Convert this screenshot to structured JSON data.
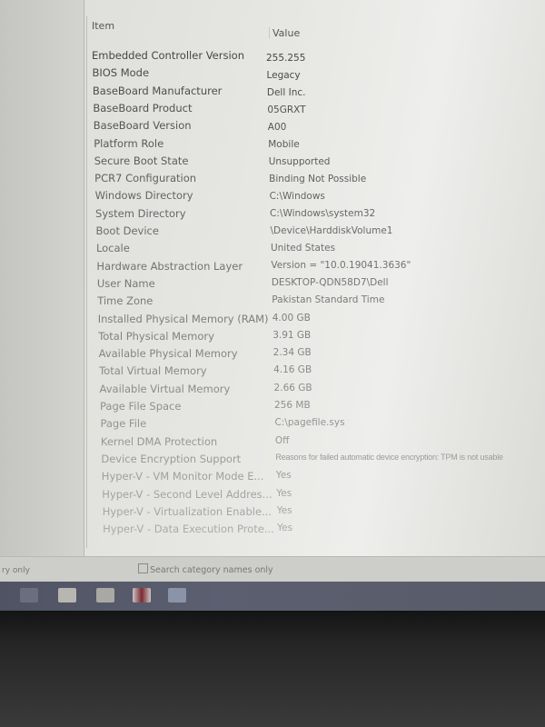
{
  "header": {
    "item": "Item",
    "value": "Value"
  },
  "rows": [
    {
      "item": "Embedded Controller Version",
      "value": "255.255"
    },
    {
      "item": "BIOS Mode",
      "value": "Legacy"
    },
    {
      "item": "BaseBoard Manufacturer",
      "value": "Dell Inc."
    },
    {
      "item": "BaseBoard Product",
      "value": "05GRXT"
    },
    {
      "item": "BaseBoard Version",
      "value": "A00"
    },
    {
      "item": "Platform Role",
      "value": "Mobile"
    },
    {
      "item": "Secure Boot State",
      "value": "Unsupported"
    },
    {
      "item": "PCR7 Configuration",
      "value": "Binding Not Possible"
    },
    {
      "item": "Windows Directory",
      "value": "C:\\Windows"
    },
    {
      "item": "System Directory",
      "value": "C:\\Windows\\system32"
    },
    {
      "item": "Boot Device",
      "value": "\\Device\\HarddiskVolume1"
    },
    {
      "item": "Locale",
      "value": "United States"
    },
    {
      "item": "Hardware Abstraction Layer",
      "value": "Version = \"10.0.19041.3636\""
    },
    {
      "item": "User Name",
      "value": "DESKTOP-QDN58D7\\Dell"
    },
    {
      "item": "Time Zone",
      "value": "Pakistan Standard Time"
    },
    {
      "item": "Installed Physical Memory (RAM)",
      "value": "4.00 GB"
    },
    {
      "item": "Total Physical Memory",
      "value": "3.91 GB"
    },
    {
      "item": "Available Physical Memory",
      "value": "2.34 GB"
    },
    {
      "item": "Total Virtual Memory",
      "value": "4.16 GB"
    },
    {
      "item": "Available Virtual Memory",
      "value": "2.66 GB"
    },
    {
      "item": "Page File Space",
      "value": "256 MB"
    },
    {
      "item": "Page File",
      "value": "C:\\pagefile.sys"
    },
    {
      "item": "Kernel DMA Protection",
      "value": "Off"
    },
    {
      "item": "Device Encryption Support",
      "value": "Reasons for failed automatic device encryption: TPM is not usable"
    },
    {
      "item": "Hyper-V - VM Monitor Mode E...",
      "value": "Yes"
    },
    {
      "item": "Hyper-V - Second Level Addres...",
      "value": "Yes"
    },
    {
      "item": "Hyper-V - Virtualization Enable...",
      "value": "Yes"
    },
    {
      "item": "Hyper-V - Data Execution Prote...",
      "value": "Yes"
    }
  ],
  "footer": {
    "left_label": "ry only",
    "search_category_label": "Search category names only",
    "search_category_checked": false
  },
  "taskbar": {
    "icons": [
      "search-icon",
      "file-explorer-icon",
      "mail-icon",
      "photos-icon",
      "system-information-icon"
    ]
  }
}
